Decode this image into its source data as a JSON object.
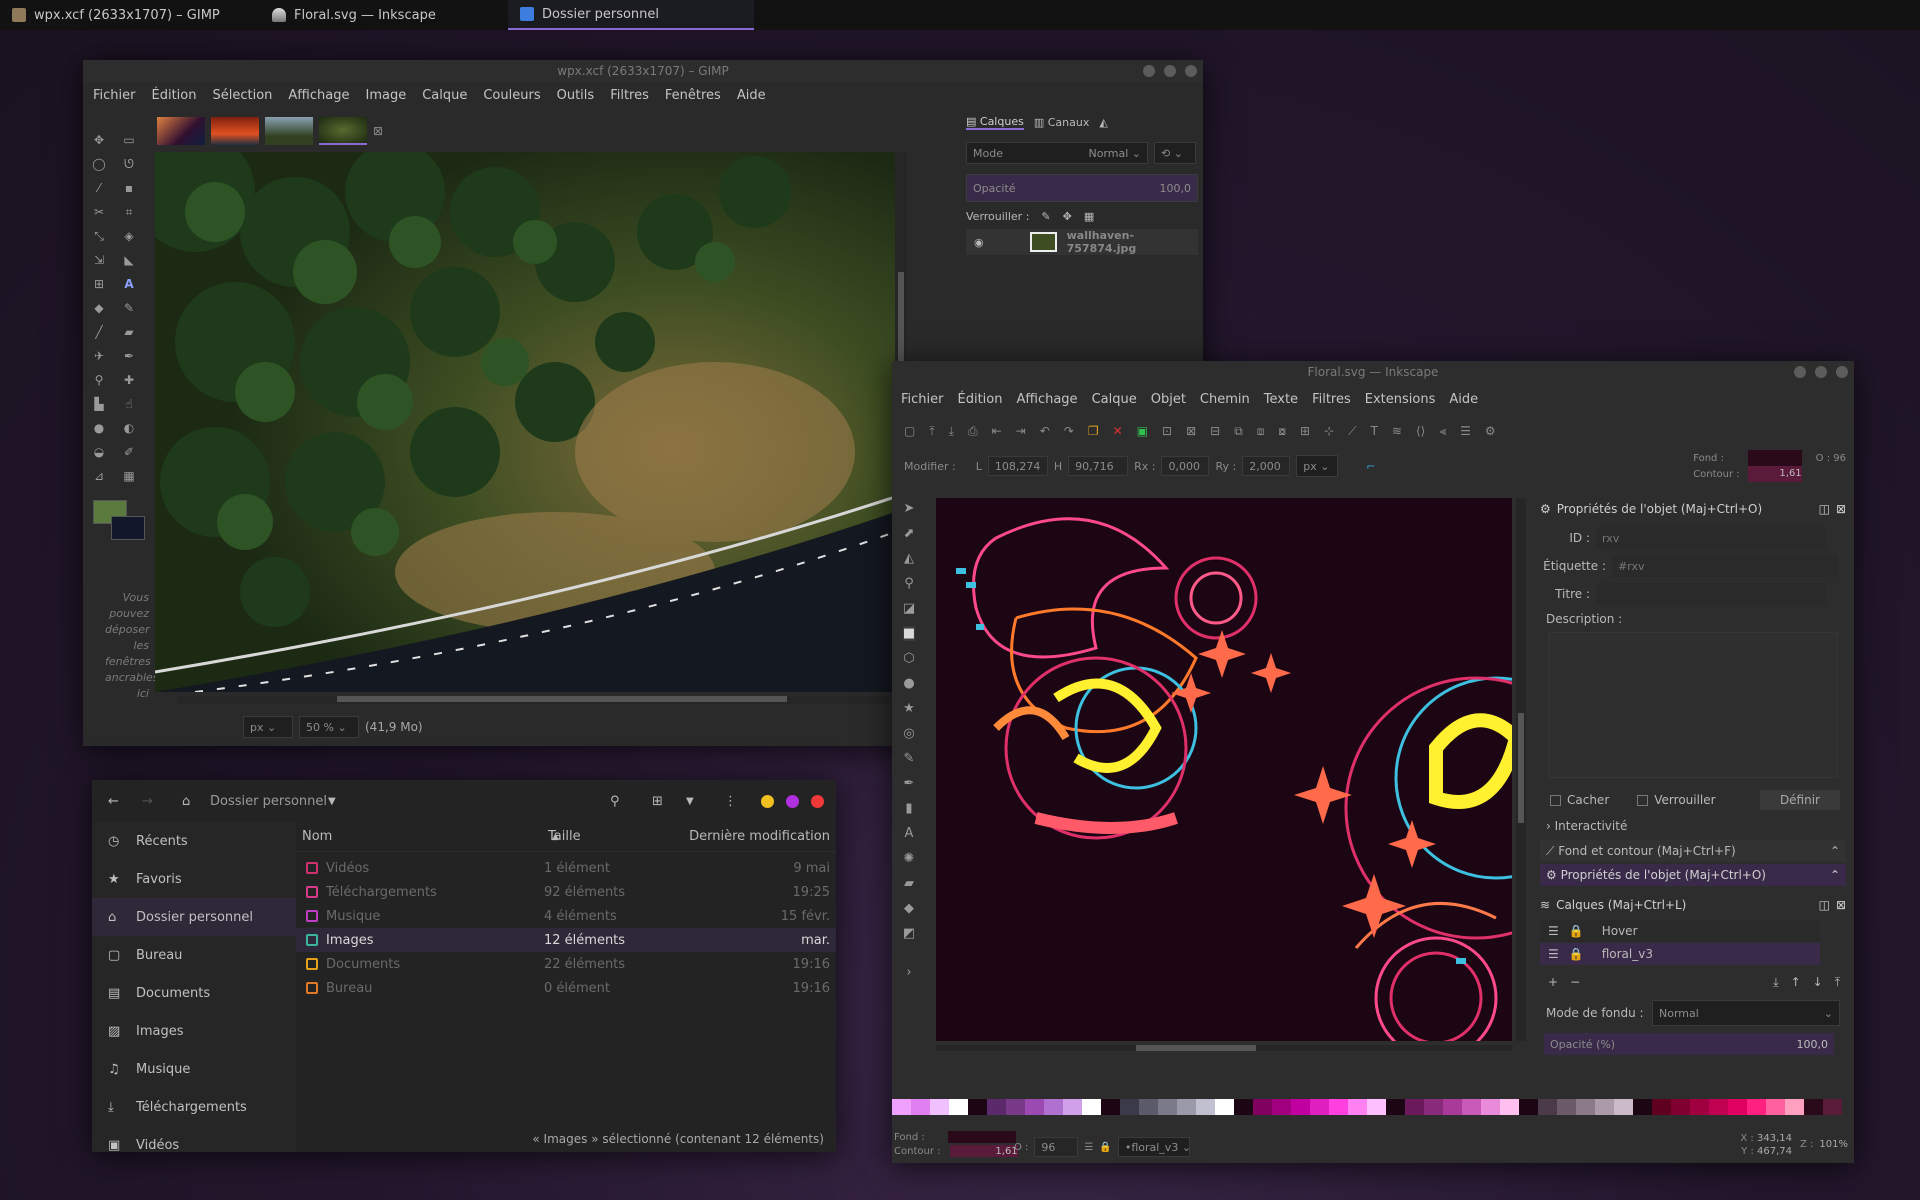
{
  "taskbar": {
    "items": [
      {
        "label": "wpx.xcf (2633x1707) – GIMP",
        "color": "#8e7a5a"
      },
      {
        "label": "Floral.svg — Inkscape",
        "color": "#c8c8c8"
      },
      {
        "label": "Dossier personnel",
        "color": "#3d7de0"
      }
    ]
  },
  "gimp": {
    "title": "wpx.xcf (2633x1707) – GIMP",
    "menu": [
      "Fichier",
      "Édition",
      "Sélection",
      "Affichage",
      "Image",
      "Calque",
      "Couleurs",
      "Outils",
      "Filtres",
      "Fenêtres",
      "Aide"
    ],
    "drop_hint": "Vous pouvez déposer les fenêtres ancrables ici",
    "status": {
      "unit": "px",
      "zoom": "50 %",
      "size": "(41,9 Mo)"
    },
    "layers_tabs": [
      "Calques",
      "Canaux"
    ],
    "mode_label": "Mode",
    "mode_value": "Normal",
    "opacity_label": "Opacité",
    "opacity_value": "100,0",
    "lock_label": "Verrouiller :",
    "layer_name": "wallhaven-757874.jpg",
    "colors": {
      "fg": "#5a7a3e",
      "bg": "#12182a"
    }
  },
  "files": {
    "location": "Dossier personnel",
    "sidebar": [
      {
        "icon": "clock-icon",
        "label": "Récents"
      },
      {
        "icon": "star-icon",
        "label": "Favoris"
      },
      {
        "icon": "home-icon",
        "label": "Dossier personnel"
      },
      {
        "icon": "folder-icon",
        "label": "Bureau"
      },
      {
        "icon": "document-icon",
        "label": "Documents"
      },
      {
        "icon": "image-icon",
        "label": "Images"
      },
      {
        "icon": "music-icon",
        "label": "Musique"
      },
      {
        "icon": "download-icon",
        "label": "Téléchargements"
      },
      {
        "icon": "video-icon",
        "label": "Vidéos"
      }
    ],
    "columns": {
      "name": "Nom",
      "size": "Taille",
      "modified": "Dernière modification"
    },
    "rows": [
      {
        "name": "Vidéos",
        "size": "1 élément",
        "date": "9 mai",
        "color": "#d0306e"
      },
      {
        "name": "Téléchargements",
        "size": "92 éléments",
        "date": "19:25",
        "color": "#d83a8a"
      },
      {
        "name": "Musique",
        "size": "4 éléments",
        "date": "15 févr.",
        "color": "#c03cc0"
      },
      {
        "name": "Images",
        "size": "12 éléments",
        "date": "mar.",
        "color": "#39b59a"
      },
      {
        "name": "Documents",
        "size": "22 éléments",
        "date": "19:16",
        "color": "#e3a21a"
      },
      {
        "name": "Bureau",
        "size": "0 élément",
        "date": "19:16",
        "color": "#e07a2a"
      }
    ],
    "status": "« Images » sélectionné  (contenant 12 éléments)"
  },
  "inkscape": {
    "title": "Floral.svg — Inkscape",
    "menu": [
      "Fichier",
      "Édition",
      "Affichage",
      "Calque",
      "Objet",
      "Chemin",
      "Texte",
      "Filtres",
      "Extensions",
      "Aide"
    ],
    "modifier_label": "Modifier :",
    "w_label": "L",
    "w": "108,274",
    "h_label": "H",
    "h": "90,716",
    "rx_label": "Rx :",
    "rx": "0,000",
    "ry_label": "Ry :",
    "ry": "2,000",
    "unit": "px",
    "fill_label": "Fond :",
    "stroke_label": "Contour :",
    "stroke_width": "1,61",
    "opacity_short": "O : 96",
    "props": {
      "header": "Propriétés de l'objet (Maj+Ctrl+O)",
      "id_label": "ID :",
      "id_value": "rxv",
      "label_label": "Étiquette :",
      "label_value": "#rxv",
      "title_label": "Titre :",
      "desc_label": "Description :",
      "hide": "Cacher",
      "lock": "Verrouiller",
      "define": "Définir",
      "interactivity": "Interactivité",
      "fill_stroke_tab": "Fond et contour (Maj+Ctrl+F)",
      "props_tab": "Propriétés de l'objet (Maj+Ctrl+O)"
    },
    "layers": {
      "header": "Calques (Maj+Ctrl+L)",
      "items": [
        "Hover",
        "floral_v3"
      ],
      "blend_label": "Mode de fondu :",
      "blend_value": "Normal",
      "opacity_label": "Opacité (%)",
      "opacity_value": "100,0"
    },
    "status": {
      "fill": "Fond :",
      "stroke": "Contour :",
      "stroke_w": "1,61",
      "o_label": "O :",
      "o_value": "96",
      "layer": "•floral_v3",
      "x": "343,14",
      "y": "467,74",
      "x_label": "X :",
      "y_label": "Y :",
      "z_label": "Z :",
      "zoom": "101%"
    },
    "fill_color": "#2a0a18",
    "stroke_color": "#5a1a3a"
  }
}
